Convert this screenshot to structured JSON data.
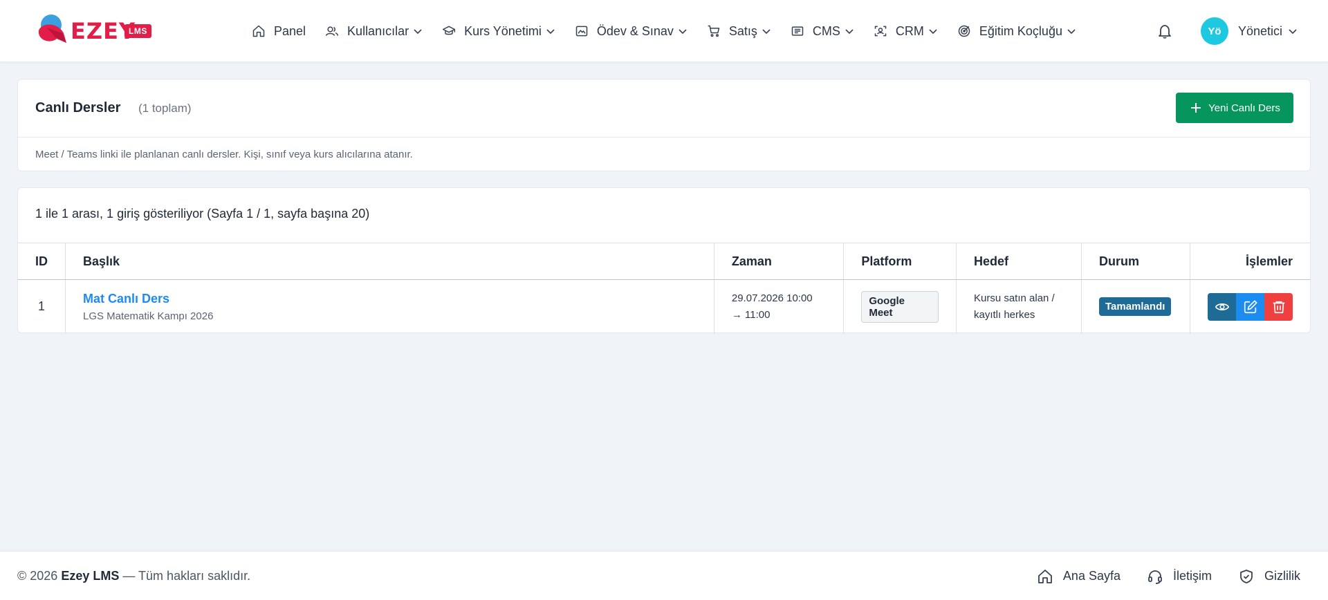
{
  "brand": {
    "name": "EZEY",
    "badge": "LMS"
  },
  "nav": [
    {
      "label": "Panel",
      "icon": "home-icon",
      "dropdown": false
    },
    {
      "label": "Kullanıcılar",
      "icon": "users-icon",
      "dropdown": true
    },
    {
      "label": "Kurs Yönetimi",
      "icon": "graduation-cap-icon",
      "dropdown": true
    },
    {
      "label": "Ödev & Sınav",
      "icon": "image-icon",
      "dropdown": true
    },
    {
      "label": "Satış",
      "icon": "cart-icon",
      "dropdown": true
    },
    {
      "label": "CMS",
      "icon": "newspaper-icon",
      "dropdown": true
    },
    {
      "label": "CRM",
      "icon": "scan-user-icon",
      "dropdown": true
    },
    {
      "label": "Eğitim Koçluğu",
      "icon": "target-icon",
      "dropdown": true
    }
  ],
  "user": {
    "initials": "Yö",
    "name": "Yönetici",
    "avatar_color": "#1ec8e1"
  },
  "header_card": {
    "title": "Canlı Dersler",
    "count": "(1 toplam)",
    "new_button": "Yeni Canlı Ders",
    "description": "Meet / Teams linki ile planlanan canlı dersler. Kişi, sınıf veya kurs alıcılarına atanır."
  },
  "table": {
    "showing": "1 ile 1 arası, 1 giriş gösteriliyor (Sayfa 1 / 1, sayfa başına 20)",
    "columns": [
      "ID",
      "Başlık",
      "Zaman",
      "Platform",
      "Hedef",
      "Durum",
      "İşlemler"
    ],
    "rows": [
      {
        "id": "1",
        "title": "Mat Canlı Ders",
        "subtitle": "LGS Matematik Kampı 2026",
        "time_start": "29.07.2026 10:00",
        "time_end": "→ 11:00",
        "platform": "Google Meet",
        "target": "Kursu satın alan / kayıtlı herkes",
        "status": "Tamamlandı"
      }
    ]
  },
  "footer": {
    "year": "© 2026",
    "company": "Ezey LMS",
    "rights": "— Tüm hakları saklıdır.",
    "links": [
      {
        "label": "Ana Sayfa",
        "icon": "home-icon"
      },
      {
        "label": "İletişim",
        "icon": "headset-icon"
      },
      {
        "label": "Gizlilik",
        "icon": "shield-check-icon"
      }
    ]
  },
  "colors": {
    "brand": "#e11d48",
    "primary_button": "#07955e",
    "link": "#1d8cf0",
    "status": "#1d6b96",
    "delete": "#ef3f3f",
    "background": "#f0f3f8"
  }
}
